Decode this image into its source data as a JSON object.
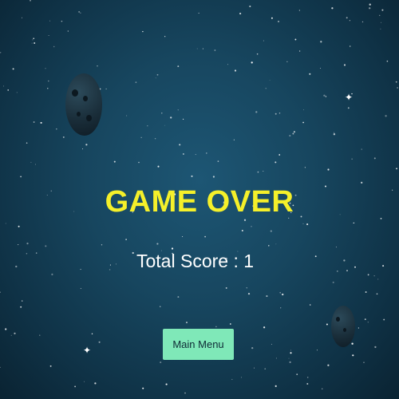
{
  "game": {
    "title": "GAME OVER",
    "score_label": "Total Score : ",
    "score_value": "1",
    "main_menu_label": "Main Menu"
  },
  "colors": {
    "title": "#f5f02a",
    "button": "#7fe8b8",
    "background": "#17465f"
  }
}
